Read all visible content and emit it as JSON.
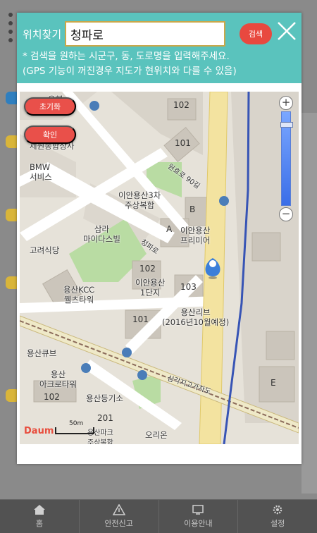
{
  "dialog": {
    "search_label": "위치찾기",
    "search_value": "청파로",
    "search_button": "검색",
    "help_line1": "* 검색을 원하는 시군구, 동, 도로명을 입력해주세요.",
    "help_line2": "(GPS 기능이 꺼진경우 지도가 현위치와 다를 수 있음)"
  },
  "map": {
    "reset_label": "초기화",
    "confirm_label": "확인",
    "zoom_in": "+",
    "zoom_out": "−",
    "logo": "Daum",
    "scale": "50m",
    "colors": {
      "road": "#ffffff",
      "main_road": "#f3e3a0",
      "park": "#b9dca3",
      "block": "#d9d4cb",
      "building": "#cfc9bf",
      "metro": "#3754b5"
    },
    "labels": {
      "bank": "은행",
      "bldg_102_top": "102",
      "bldg_101_top": "101",
      "wonhyo": "제원종합상사",
      "bmw": "BMW\n서비스",
      "road_wonhyo": "원효로 90길",
      "iaan3": "이안용산3차\n주상복합",
      "b_label": "B",
      "a_label": "A",
      "iaan_premier": "이안용산\n프리미어",
      "samra": "삼라\n마이다스빌",
      "goryeo": "고려식당",
      "cheongpa_road": "청파로",
      "bldg_102_mid": "102",
      "iaan1": "이안용산\n1단지",
      "bldg_103": "103",
      "kcc": "용산KCC\n웰츠타워",
      "bldg_101_mid": "101",
      "yongsan_live": "용산리브\n(2016년10월예정)",
      "yongsan_cube": "용산큐브",
      "yongsan_acro": "용산\n아크로타워",
      "bldg_102_bot": "102",
      "samgakji": "삼각지고가차도",
      "registry": "용산등기소",
      "bldg_201": "201",
      "e_label": "E",
      "orion": "오리온",
      "bottom_cut": "용산파크\n주상복합"
    }
  },
  "bottom_nav": [
    {
      "label": "홈",
      "icon": "home-icon"
    },
    {
      "label": "안전신고",
      "icon": "alert-icon"
    },
    {
      "label": "이용안내",
      "icon": "guide-icon"
    },
    {
      "label": "설정",
      "icon": "gear-icon"
    }
  ]
}
